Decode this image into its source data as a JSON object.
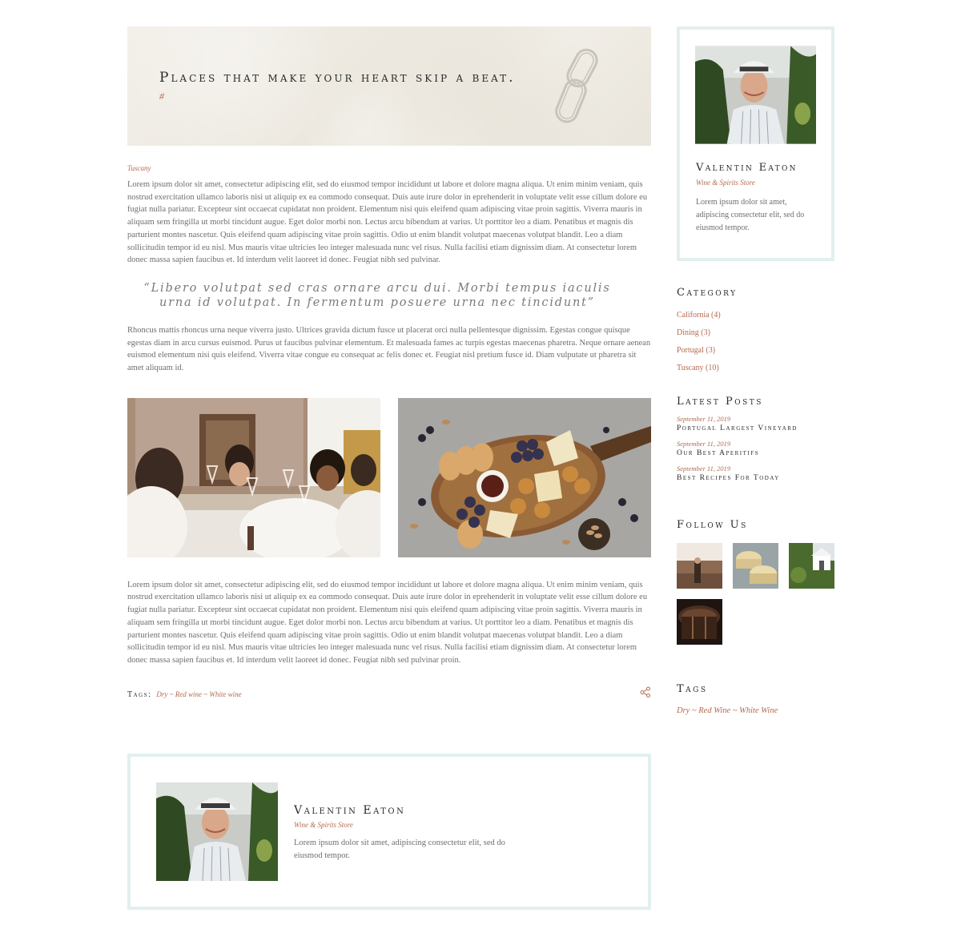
{
  "banner": {
    "title": "Places that make your heart skip a beat.",
    "hash": "#"
  },
  "post": {
    "category": "Tuscany",
    "paragraph1": "Lorem ipsum dolor sit amet, consectetur adipiscing elit, sed do eiusmod tempor incididunt ut labore et dolore magna aliqua. Ut enim minim veniam, quis nostrud exercitation ullamco laboris nisi ut aliquip ex ea commodo consequat. Duis aute irure dolor in eprehenderit in voluptate velit esse cillum dolore eu fugiat nulla pariatur. Excepteur sint occaecat cupidatat non proident. Elementum nisi quis eleifend quam adipiscing vitae proin sagittis. Viverra mauris in aliquam sem fringilla ut morbi tincidunt augue. Eget dolor morbi non. Lectus arcu bibendum at varius. Ut porttitor leo a diam. Penatibus et magnis dis parturient montes nascetur. Quis eleifend quam adipiscing vitae proin sagittis. Odio ut enim blandit volutpat maecenas volutpat blandit. Leo a diam sollicitudin tempor id eu nisl. Mus mauris vitae ultricies leo integer malesuada nunc vel risus. Nulla facilisi etiam dignissim diam. At consectetur lorem donec massa sapien faucibus et. Id interdum velit laoreet id donec. Feugiat nibh sed pulvinar.",
    "quote": "“Libero volutpat sed cras ornare arcu dui. Morbi tempus iaculis urna id volutpat. In fermentum posuere urna nec tincidunt”",
    "paragraph2": "Rhoncus mattis rhoncus urna neque viverra justo. Ultrices gravida dictum fusce ut placerat orci nulla pellentesque dignissim. Egestas congue quisque egestas diam in arcu cursus euismod. Purus ut faucibus pulvinar elementum. Et malesuada fames ac turpis egestas maecenas pharetra. Neque ornare aenean euismod elementum nisi quis eleifend. Viverra vitae congue eu consequat ac felis donec et. Feugiat nisl pretium fusce id. Diam vulputate ut pharetra sit amet aliquam id.",
    "paragraph3": "Lorem ipsum dolor sit amet, consectetur adipiscing elit, sed do eiusmod tempor incididunt ut labore et dolore magna aliqua. Ut enim minim veniam, quis nostrud exercitation ullamco laboris nisi ut aliquip ex ea commodo consequat. Duis aute irure dolor in eprehenderit in voluptate velit esse cillum dolore eu fugiat nulla pariatur. Excepteur sint occaecat cupidatat non proident. Elementum nisi quis eleifend quam adipiscing vitae proin sagittis. Viverra mauris in aliquam sem fringilla ut morbi tincidunt augue. Eget dolor morbi non. Lectus arcu bibendum at varius. Ut porttitor leo a diam. Penatibus et magnis dis parturient montes nascetur. Quis eleifend quam adipiscing vitae proin sagittis. Odio ut enim blandit volutpat maecenas volutpat blandit. Leo a diam sollicitudin tempor id eu nisl. Mus mauris vitae ultricies leo integer malesuada nunc vel risus. Nulla facilisi etiam dignissim diam. At consectetur lorem donec massa sapien faucibus et. Id interdum velit laoreet id donec. Feugiat nibh sed pulvinar proin.",
    "tags_label": "Tags:",
    "tags": "Dry ~ Red wine ~ White wine"
  },
  "author": {
    "name": "Valentin Eaton",
    "role": "Wine & Spirits Store",
    "bio_long": "Lorem ipsum dolor sit amet, adipiscing consectetur elit, sed do eiusmod tempor.",
    "bio_short": "Lorem ipsum dolor sit amet, adipiscing consectetur elit, sed do eiusmod tempor."
  },
  "sidebar": {
    "category_title": "Category",
    "categories": [
      {
        "label": "California (4)"
      },
      {
        "label": "Dining (3)"
      },
      {
        "label": "Portugal (3)"
      },
      {
        "label": "Tuscany (10)"
      }
    ],
    "latest_title": "Latest Posts",
    "posts": [
      {
        "date": "September 11, 2019",
        "title": "Portugal Largest Vineyard"
      },
      {
        "date": "September 11, 2019",
        "title": "Our Best Aperitifs"
      },
      {
        "date": "September 11, 2019",
        "title": "Best Recipes For Today"
      }
    ],
    "follow_title": "Follow Us",
    "tags_title": "Tags",
    "tags": "Dry ~ Red Wine ~ White Wine"
  },
  "colors": {
    "accent": "#b46a4e",
    "heading": "#2a2a2a",
    "body_text": "#6e6e6e",
    "box_border": "#e2efef",
    "banner_bg": "#efece5"
  },
  "icons": {
    "banner": "chain-link-icon",
    "share": "share-icon"
  }
}
